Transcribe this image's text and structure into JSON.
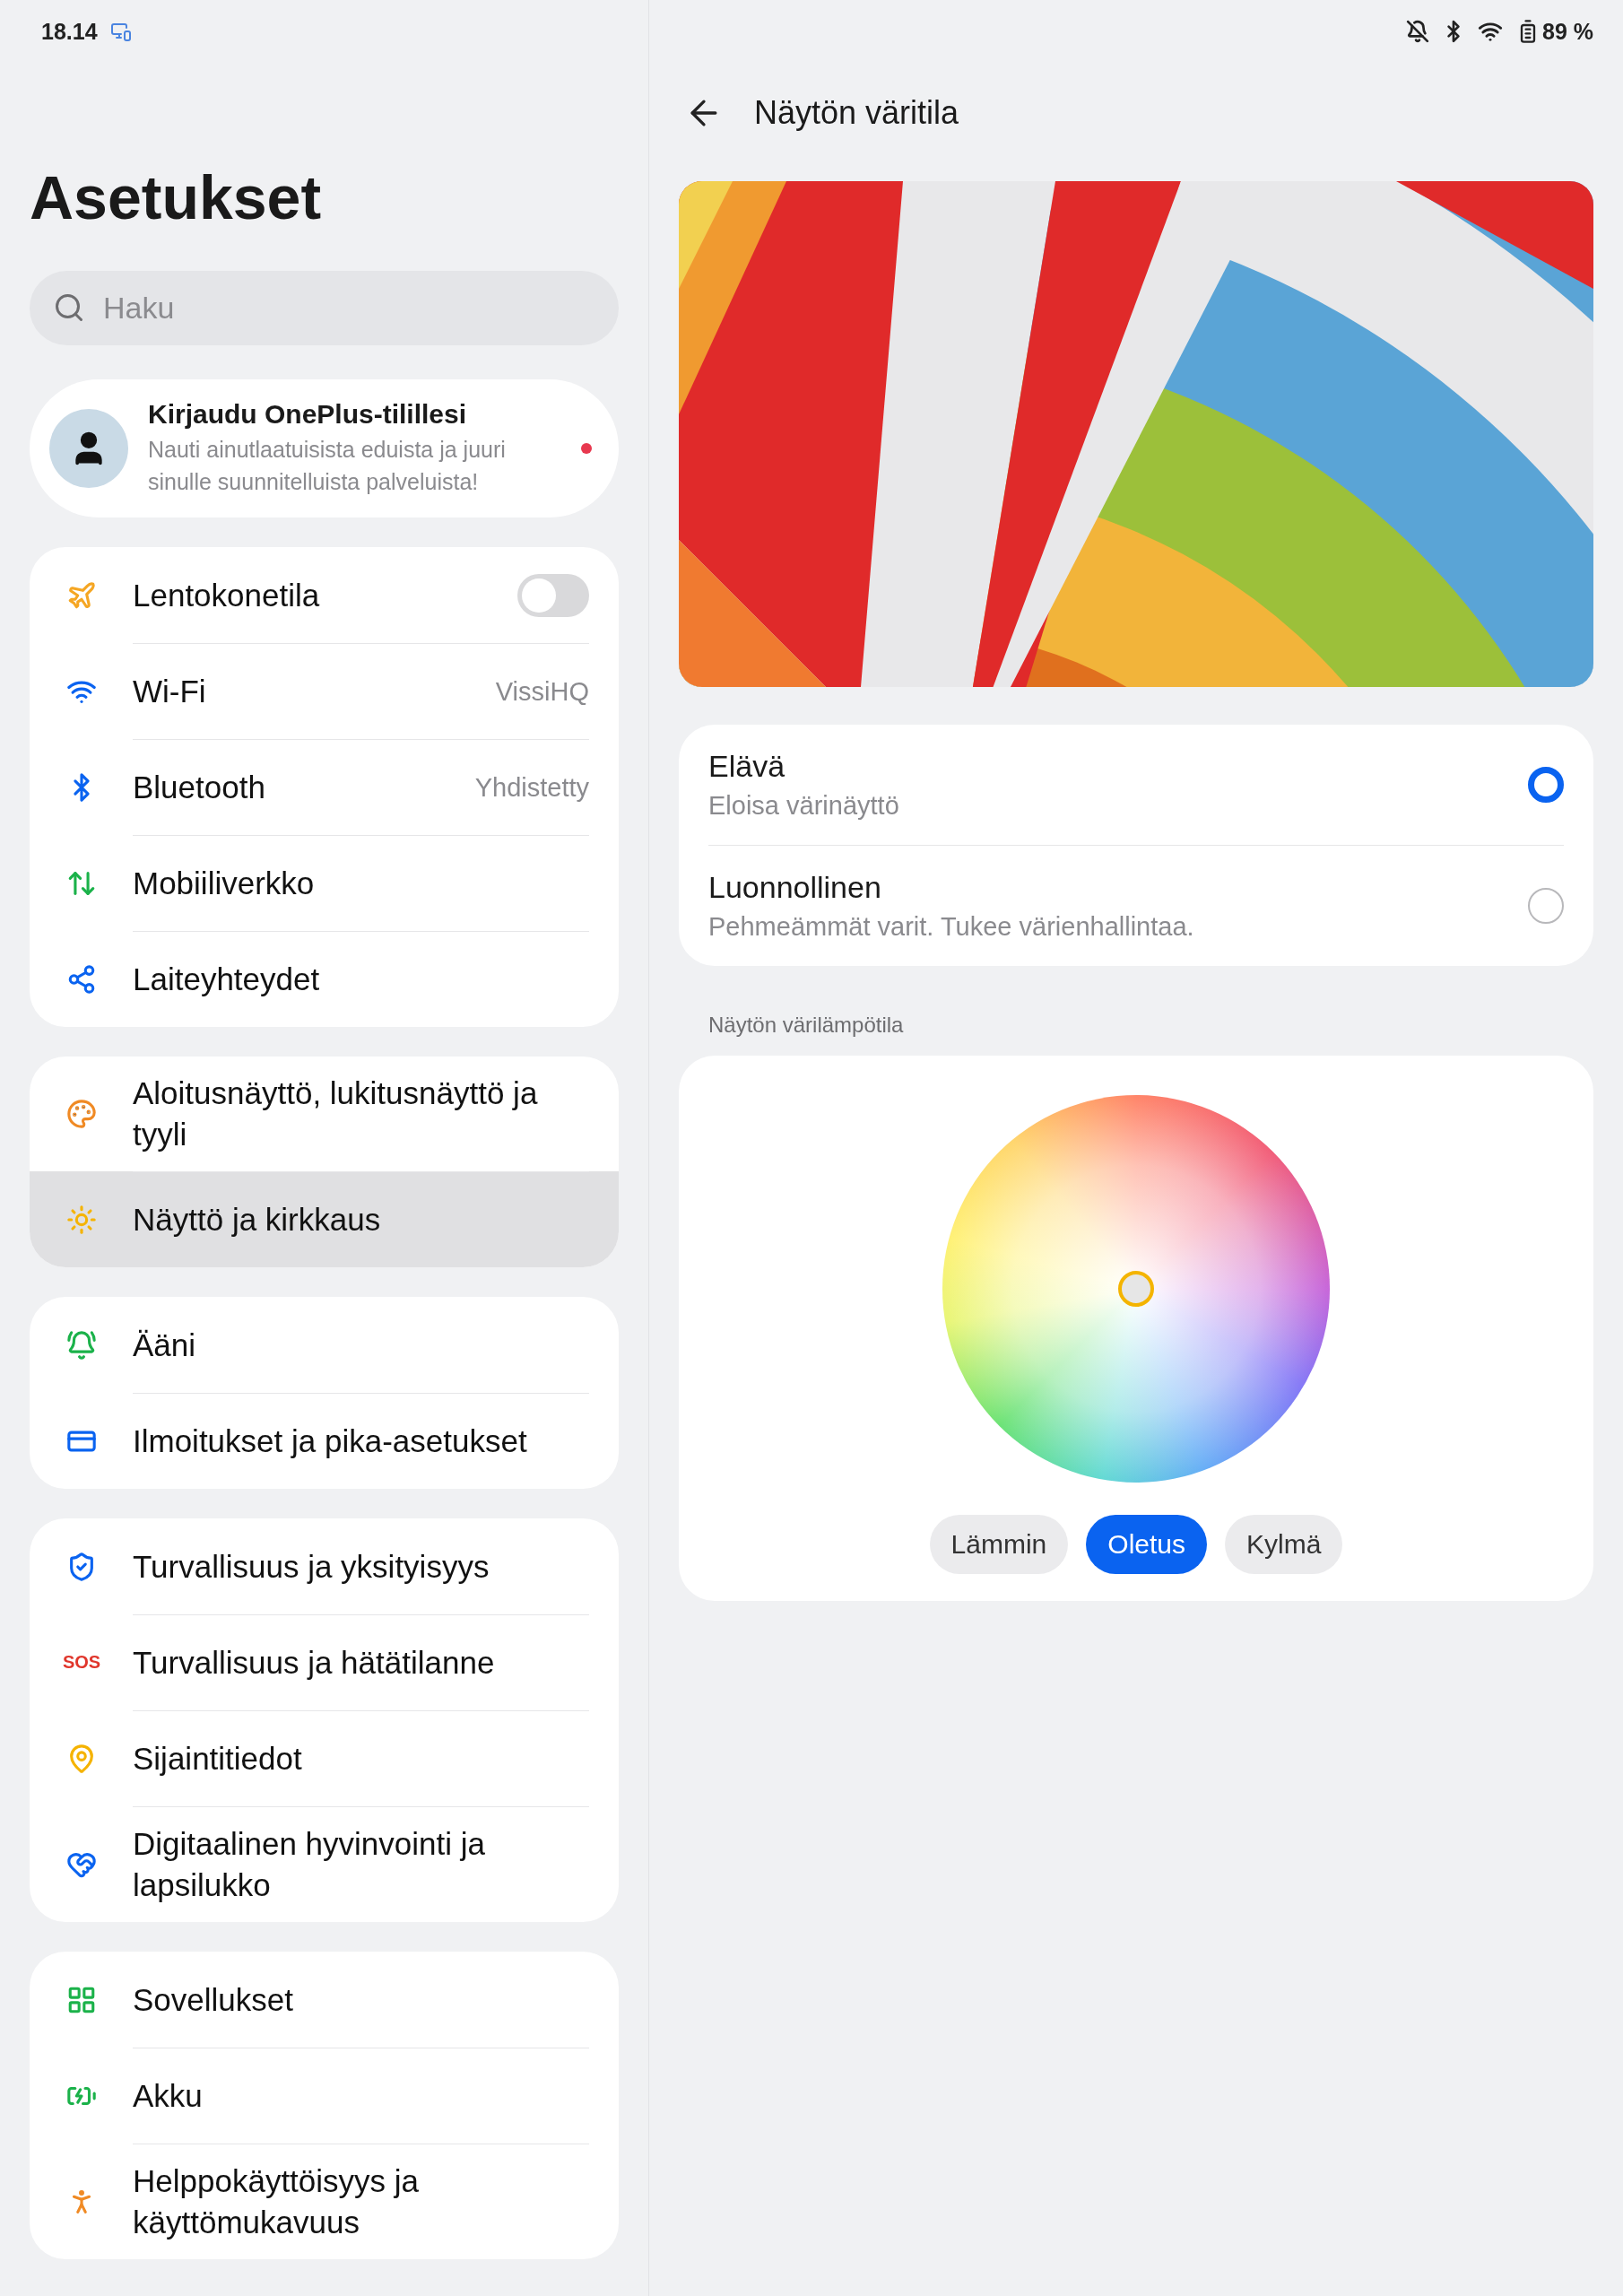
{
  "status_bar": {
    "time": "18.14",
    "battery": "89 %"
  },
  "sidebar": {
    "title": "Asetukset",
    "search": {
      "placeholder": "Haku"
    },
    "account": {
      "title": "Kirjaudu OnePlus-tilillesi",
      "subtitle": "Nauti ainutlaatuisista eduista ja juuri sinulle suunnitelluista palveluista!",
      "unread": true
    },
    "groups": [
      {
        "items": [
          {
            "label": "Lentokonetila",
            "kind": "toggle",
            "on": false,
            "selected": false
          },
          {
            "label": "Wi-Fi",
            "kind": "value",
            "value": "VissiHQ",
            "selected": false
          },
          {
            "label": "Bluetooth",
            "kind": "value",
            "value": "Yhdistetty",
            "selected": false
          },
          {
            "label": "Mobiiliverkko",
            "kind": "link",
            "selected": false
          },
          {
            "label": "Laiteyhteydet",
            "kind": "link",
            "selected": false
          }
        ]
      },
      {
        "items": [
          {
            "label": "Aloitusnäyttö, lukitusnäyttö ja tyyli",
            "kind": "link",
            "selected": false
          },
          {
            "label": "Näyttö ja kirkkaus",
            "kind": "link",
            "selected": true
          }
        ]
      },
      {
        "items": [
          {
            "label": "Ääni",
            "kind": "link",
            "selected": false
          },
          {
            "label": "Ilmoitukset ja pika-asetukset",
            "kind": "link",
            "selected": false
          }
        ]
      },
      {
        "items": [
          {
            "label": "Turvallisuus ja yksityisyys",
            "kind": "link",
            "selected": false
          },
          {
            "label": "Turvallisuus ja hätätilanne",
            "kind": "link",
            "icon_text": "SOS",
            "selected": false
          },
          {
            "label": "Sijaintitiedot",
            "kind": "link",
            "selected": false
          },
          {
            "label": "Digitaalinen hyvinvointi ja lapsilukko",
            "kind": "link",
            "selected": false
          }
        ]
      },
      {
        "items": [
          {
            "label": "Sovellukset",
            "kind": "link",
            "selected": false
          },
          {
            "label": "Akku",
            "kind": "link",
            "selected": false
          },
          {
            "label": "Helppokäyttöisyys ja käyttömukavuus",
            "kind": "link",
            "selected": false
          }
        ]
      }
    ]
  },
  "detail": {
    "title": "Näytön väritila",
    "modes": [
      {
        "title": "Elävä",
        "subtitle": "Eloisa värinäyttö",
        "selected": true
      },
      {
        "title": "Luonnollinen",
        "subtitle": "Pehmeämmät varit. Tukee värienhallintaa.",
        "selected": false
      }
    ],
    "temperature": {
      "label": "Näytön värilämpötila",
      "presets": [
        {
          "label": "Lämmin",
          "selected": false
        },
        {
          "label": "Oletus",
          "selected": true
        },
        {
          "label": "Kylmä",
          "selected": false
        }
      ]
    }
  }
}
